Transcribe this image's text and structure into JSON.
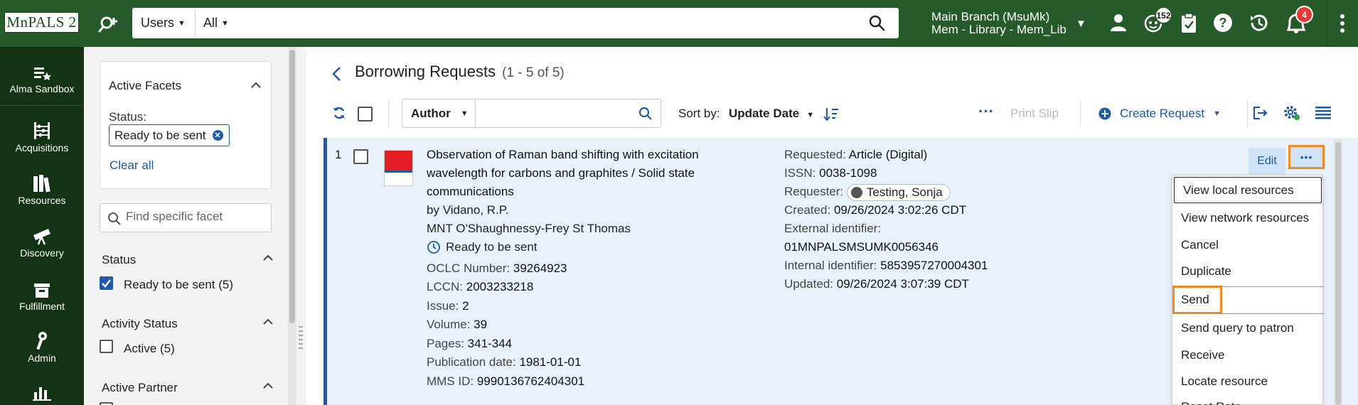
{
  "header": {
    "logo_text": "MnPALS 2",
    "search_scope": "Users",
    "search_filter": "All",
    "search_placeholder": "",
    "branch_line1": "Main Branch (MsuMk)",
    "branch_line2": "Mem - Library - Mem_Lib",
    "tasks_count": "152",
    "notifications_count": "4",
    "colors": {
      "brand": "#275a2a",
      "rail": "#133314",
      "accent": "#1e5aa8",
      "highlight": "#f08a24",
      "badge": "#e53935"
    }
  },
  "leftnav": {
    "items": [
      {
        "label": "Alma Sandbox",
        "icon": "list-star-icon"
      },
      {
        "label": "Acquisitions",
        "icon": "abacus-icon"
      },
      {
        "label": "Resources",
        "icon": "books-icon"
      },
      {
        "label": "Discovery",
        "icon": "telescope-icon"
      },
      {
        "label": "Fulfillment",
        "icon": "box-icon"
      },
      {
        "label": "Admin",
        "icon": "wrench-icon"
      },
      {
        "label": "",
        "icon": "analytics-icon"
      }
    ]
  },
  "facets": {
    "active_title": "Active Facets",
    "status_label": "Status:",
    "chip_value": "Ready to be sent",
    "clear_all": "Clear all",
    "search_placeholder": "Find specific facet",
    "status_section": "Status",
    "status_option": "Ready to be sent",
    "status_option_count": "(5)",
    "activity_section": "Activity Status",
    "activity_option": "Active",
    "activity_option_count": "(5)",
    "partner_section": "Active Partner"
  },
  "main": {
    "title": "Borrowing Requests",
    "count": "(1 - 5 of 5)",
    "search_field": "Author",
    "search_value": "",
    "sort_label": "Sort by:",
    "sort_value": "Update Date",
    "more_actions": "···",
    "print_slip": "Print Slip",
    "create_request": "Create Request"
  },
  "record": {
    "index": "1",
    "title_lines": [
      "Observation of Raman band shifting with excitation",
      "wavelength for carbons and graphites / Solid state",
      "communications"
    ],
    "author_prefix": "by",
    "author": "Vidano, R.P.",
    "library": "MNT O'Shaughnessy-Frey St Thomas",
    "status": "Ready to be sent",
    "left_fields": [
      {
        "label": "OCLC Number:",
        "value": "39264923"
      },
      {
        "label": "LCCN:",
        "value": "2003233218"
      },
      {
        "label": "Issue:",
        "value": "2"
      },
      {
        "label": "Volume:",
        "value": "39"
      },
      {
        "label": "Pages:",
        "value": "341-344"
      },
      {
        "label": "Publication date:",
        "value": "1981-01-01"
      },
      {
        "label": "MMS ID:",
        "value": "9990136762404301"
      }
    ],
    "requested_label": "Requested:",
    "requested_value": "Article (Digital)",
    "issn_label": "ISSN:",
    "issn_value": "0038-1098",
    "requester_label": "Requester:",
    "requester_value": "Testing, Sonja",
    "created_label": "Created:",
    "created_value": "09/26/2024 3:02:26 CDT",
    "external_label": "External identifier:",
    "external_value": "01MNPALSMSUMK0056346",
    "internal_label": "Internal identifier:",
    "internal_value": "5853957270004301",
    "updated_label": "Updated:",
    "updated_value": "09/26/2024 3:07:39 CDT",
    "edit_label": "Edit",
    "more_label": "•••"
  },
  "menu": {
    "items": [
      "View local resources",
      "View network resources",
      "Cancel",
      "Duplicate",
      "Send",
      "Send query to patron",
      "Receive",
      "Locate resource",
      "Reset Rota"
    ]
  }
}
